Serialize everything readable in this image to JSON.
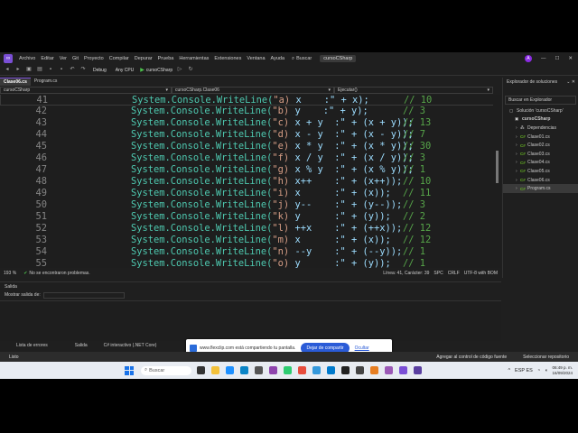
{
  "menu": {
    "items": [
      "Archivo",
      "Editar",
      "Ver",
      "Git",
      "Proyecto",
      "Compilar",
      "Depurar",
      "Prueba",
      "Herramientas",
      "Extensiones",
      "Ventana",
      "Ayuda"
    ],
    "search_label": "Buscar",
    "solution_name": "cursoCSharp",
    "avatar_letter": "A"
  },
  "toolbar": {
    "config": "Debug",
    "platform": "Any CPU",
    "run_target": "cursoCSharp"
  },
  "doc_tabs": [
    {
      "label": "Clase06.cs",
      "active": true
    },
    {
      "label": "Program.cs",
      "active": false
    }
  ],
  "nav": {
    "project": "cursoCSharp",
    "class": "cursoCSharp.Clase06",
    "member": "Ejecutar()"
  },
  "code_lines": [
    {
      "num": "41",
      "label": "\"a)",
      "expr": "x    :\" + x);",
      "comment": "// 10"
    },
    {
      "num": "42",
      "label": "\"b)",
      "expr": "y    :\" + y);",
      "comment": "// 3"
    },
    {
      "num": "43",
      "label": "\"c)",
      "expr": "x + y  :\" + (x + y));",
      "comment": "// 13"
    },
    {
      "num": "44",
      "label": "\"d)",
      "expr": "x - y  :\" + (x - y));",
      "comment": "// 7"
    },
    {
      "num": "45",
      "label": "\"e)",
      "expr": "x * y  :\" + (x * y));",
      "comment": "// 30"
    },
    {
      "num": "46",
      "label": "\"f)",
      "expr": "x / y  :\" + (x / y));",
      "comment": "// 3"
    },
    {
      "num": "47",
      "label": "\"g)",
      "expr": "x % y  :\" + (x % y));",
      "comment": "// 1"
    },
    {
      "num": "48",
      "label": "\"h)",
      "expr": "x++    :\" + (x++));",
      "comment": "// 10"
    },
    {
      "num": "49",
      "label": "\"i)",
      "expr": "x      :\" + (x));",
      "comment": "// 11"
    },
    {
      "num": "50",
      "label": "\"j)",
      "expr": "y--    :\" + (y--));",
      "comment": "// 3"
    },
    {
      "num": "51",
      "label": "\"k)",
      "expr": "y      :\" + (y));",
      "comment": "// 2"
    },
    {
      "num": "52",
      "label": "\"l)",
      "expr": "++x    :\" + (++x));",
      "comment": "// 12"
    },
    {
      "num": "53",
      "label": "\"m)",
      "expr": "x      :\" + (x));",
      "comment": "// 12"
    },
    {
      "num": "54",
      "label": "\"n)",
      "expr": "--y    :\" + (--y));",
      "comment": "// 1"
    },
    {
      "num": "55",
      "label": "\"o)",
      "expr": "y      :\" + (y));",
      "comment": "// 1"
    }
  ],
  "code_prefix": "System.Console.WriteLine(",
  "editor_status": {
    "zoom": "193 %",
    "problems": "No se encontraron problemas.",
    "position": "Línea: 41, Carácter: 39",
    "spc": "SPC",
    "eol": "CRLF",
    "encoding": "UTF-8 with BOM"
  },
  "solution_explorer": {
    "title": "Explorador de soluciones",
    "search_placeholder": "Buscar en Explorador",
    "items": [
      {
        "label": "Solución 'cursoCSharp'",
        "indent": 0,
        "icon": "solution"
      },
      {
        "label": "cursoCSharp",
        "indent": 1,
        "icon": "project"
      },
      {
        "label": "Dependencias",
        "indent": 2,
        "icon": "deps"
      },
      {
        "label": "Clase01.cs",
        "indent": 2,
        "icon": "cs"
      },
      {
        "label": "Clase02.cs",
        "indent": 2,
        "icon": "cs"
      },
      {
        "label": "Clase03.cs",
        "indent": 2,
        "icon": "cs"
      },
      {
        "label": "Clase04.cs",
        "indent": 2,
        "icon": "cs"
      },
      {
        "label": "Clase05.cs",
        "indent": 2,
        "icon": "cs"
      },
      {
        "label": "Clase06.cs",
        "indent": 2,
        "icon": "cs"
      },
      {
        "label": "Program.cs",
        "indent": 2,
        "icon": "cs",
        "selected": true
      }
    ]
  },
  "output": {
    "title": "Salida",
    "show_label": "Mostrar salida de:"
  },
  "bottom_tabs": [
    "Lista de errores",
    "Salida",
    "C# interactivo (.NET Core)"
  ],
  "share_banner": {
    "message": "www.flexclip.com está compartiendo tu pantalla.",
    "stop_button": "Dejar de compartir",
    "hide_link": "Ocultar"
  },
  "statusbar": {
    "left": "Listo",
    "add_source": "Agregar al control de código fuente",
    "select_repo": "Seleccionar repositorio"
  },
  "taskbar": {
    "search": "Buscar",
    "lang": "ESP ES",
    "time": "06:49 p. m.",
    "date": "16/09/2024"
  }
}
